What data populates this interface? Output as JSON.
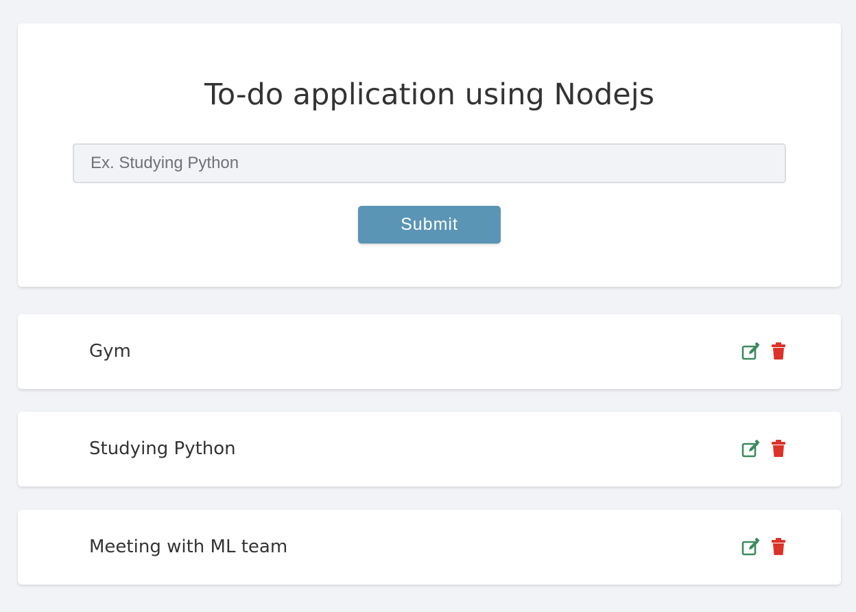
{
  "header": {
    "title": "To-do application using Nodejs"
  },
  "form": {
    "input_placeholder": "Ex. Studying Python",
    "input_value": "",
    "submit_label": "Submit"
  },
  "todos": [
    {
      "label": "Gym"
    },
    {
      "label": "Studying Python"
    },
    {
      "label": "Meeting with ML team"
    }
  ],
  "icons": {
    "edit": "edit-icon",
    "delete": "trash-icon"
  },
  "colors": {
    "background": "#f1f3f7",
    "submit_button": "#5b95b5",
    "edit_icon": "#3b8a5e",
    "delete_icon": "#dc3228"
  }
}
